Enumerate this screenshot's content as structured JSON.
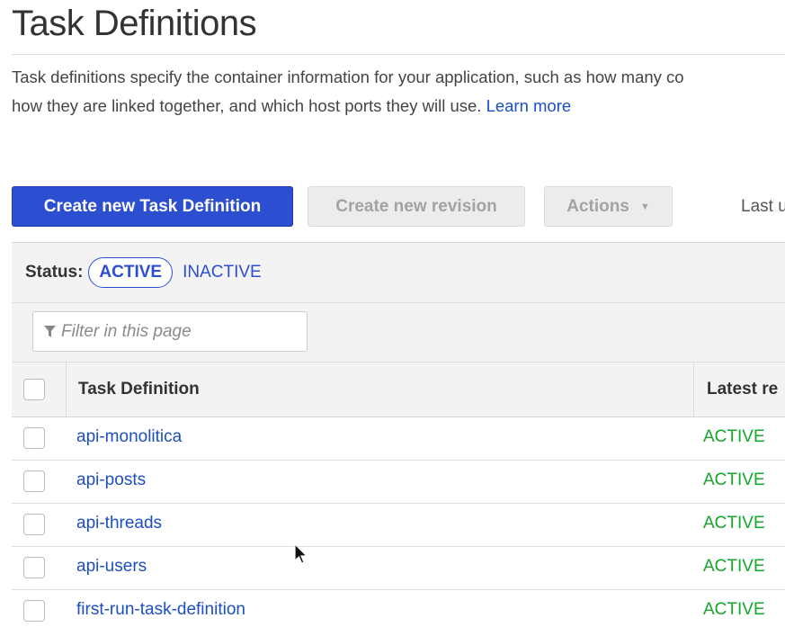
{
  "page": {
    "title": "Task Definitions",
    "description_line1": "Task definitions specify the container information for your application, such as how many co",
    "description_line2": "how they are linked together, and which host ports they will use.",
    "learn_more": "Learn more"
  },
  "toolbar": {
    "create_label": "Create new Task Definition",
    "revision_label": "Create new revision",
    "actions_label": "Actions",
    "last_updated": "Last u"
  },
  "status_filter": {
    "label": "Status:",
    "active": "ACTIVE",
    "inactive": "INACTIVE"
  },
  "filter": {
    "placeholder": "Filter in this page"
  },
  "table": {
    "headers": [
      "Task Definition",
      "Latest re"
    ],
    "rows": [
      {
        "name": "api-monolitica",
        "status": "ACTIVE"
      },
      {
        "name": "api-posts",
        "status": "ACTIVE"
      },
      {
        "name": "api-threads",
        "status": "ACTIVE"
      },
      {
        "name": "api-users",
        "status": "ACTIVE"
      },
      {
        "name": "first-run-task-definition",
        "status": "ACTIVE"
      }
    ]
  },
  "icons": {
    "filter": "filter-icon",
    "actions_caret": "caret-down-icon",
    "cursor": "mouse-pointer-icon"
  },
  "colors": {
    "primary": "#2c4ed0",
    "link": "#1b4fc2",
    "status_active": "#15a82b",
    "disabled_bg": "#ececec"
  }
}
